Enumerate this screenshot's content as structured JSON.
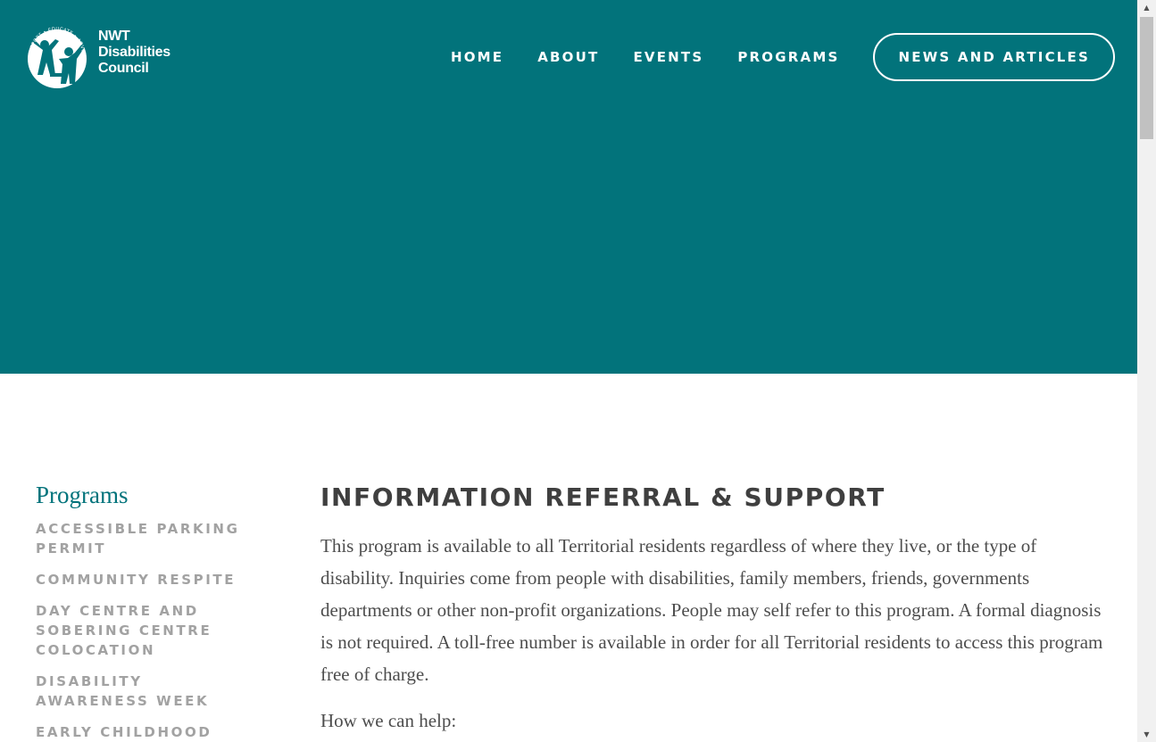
{
  "header": {
    "logo": {
      "line1": "NWT",
      "line2": "Disabilities",
      "line3": "Council",
      "ring_text": "SUPPORT • EDUCATE • ADVOCATE"
    },
    "nav": [
      {
        "label": "HOME"
      },
      {
        "label": "ABOUT"
      },
      {
        "label": "EVENTS"
      },
      {
        "label": "PROGRAMS"
      }
    ],
    "cta_label": "NEWS AND ARTICLES"
  },
  "sidebar": {
    "title": "Programs",
    "items": [
      {
        "label": "ACCESSIBLE PARKING PERMIT"
      },
      {
        "label": "COMMUNITY RESPITE"
      },
      {
        "label": "DAY CENTRE AND SOBERING CENTRE COLOCATION"
      },
      {
        "label": "DISABILITY AWARENESS WEEK"
      },
      {
        "label": "EARLY CHILDHOOD"
      }
    ]
  },
  "main": {
    "title": "INFORMATION REFERRAL & SUPPORT",
    "paragraphs": [
      "This program is available to all Territorial residents regardless of where they live, or the type of disability. Inquiries come from people with disabilities, family members, friends, governments departments or other non-profit organizations. People may self refer to this program. A formal diagnosis is not required. A toll-free number is available in order for all Territorial residents to access this program free of charge.",
      "How we can help:"
    ]
  },
  "colors": {
    "brand_teal": "#02737b",
    "sidebar_grey": "#a2a2a2",
    "heading": "#3f3f3f",
    "body_text": "#4d4d4d"
  },
  "icons": {
    "logo": "people-circle-logo-icon",
    "scroll_up": "arrow-up-icon",
    "scroll_down": "arrow-down-icon"
  }
}
